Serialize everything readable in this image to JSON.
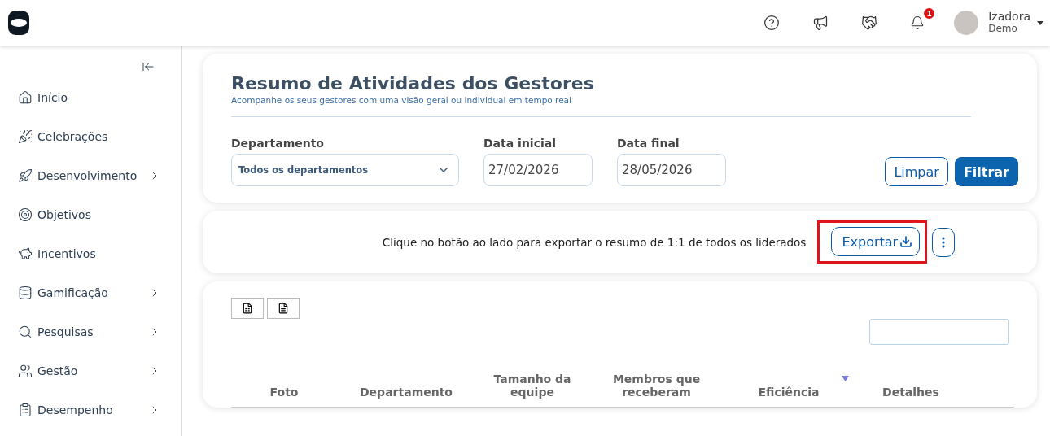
{
  "header": {
    "notifications": "1",
    "user": {
      "name": "Izadora",
      "role": "Demo"
    }
  },
  "sidebar": {
    "items": [
      {
        "label": "Início",
        "expandable": false
      },
      {
        "label": "Celebrações",
        "expandable": false
      },
      {
        "label": "Desenvolvimento",
        "expandable": true
      },
      {
        "label": "Objetivos",
        "expandable": false
      },
      {
        "label": "Incentivos",
        "expandable": false
      },
      {
        "label": "Gamificação",
        "expandable": true
      },
      {
        "label": "Pesquisas",
        "expandable": true
      },
      {
        "label": "Gestão",
        "expandable": true
      },
      {
        "label": "Desempenho",
        "expandable": true
      }
    ]
  },
  "summary": {
    "title": "Resumo de Atividades dos Gestores",
    "subtitle": "Acompanhe os seus gestores com uma visão geral ou individual em tempo real",
    "filters": [
      {
        "label": "Departamento",
        "kind": "select",
        "value": "Todos os departamentos"
      },
      {
        "label": "Data inicial",
        "kind": "date",
        "value": "27/02/2026"
      },
      {
        "label": "Data final",
        "kind": "date",
        "value": "28/05/2026"
      }
    ],
    "buttons": [
      {
        "label": "Limpar",
        "kind": "outline"
      },
      {
        "label": "Filtrar",
        "kind": "primary"
      }
    ]
  },
  "export": {
    "text": "Clique no botão ao lado para exportar o resumo de 1:1 de todos os liderados",
    "button": "Exportar",
    "highlighted": true
  },
  "table": {
    "columns": [
      {
        "label": "Foto",
        "sorted": false
      },
      {
        "label": "Departamento",
        "sorted": false
      },
      {
        "label": "Tamanho da equipe",
        "sorted": false
      },
      {
        "label": "Membros que receberam",
        "sorted": false
      },
      {
        "label": "Eficiência",
        "sorted": true
      },
      {
        "label": "Detalhes",
        "sorted": false
      }
    ]
  }
}
